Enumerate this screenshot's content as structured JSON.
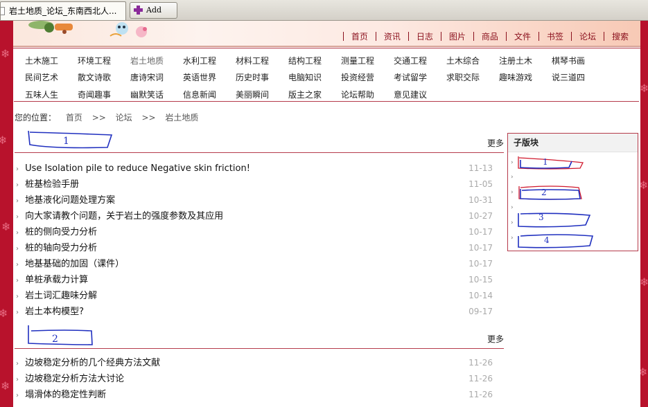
{
  "browser": {
    "active_tab": "岩土地质_论坛_东南西北人...",
    "add_tab_label": "Add Tab"
  },
  "topnav": [
    "首页",
    "资讯",
    "日志",
    "图片",
    "商品",
    "文件",
    "书签",
    "论坛",
    "搜索"
  ],
  "categories": [
    [
      "土木施工",
      "环境工程",
      "岩土地质",
      "水利工程",
      "材料工程",
      "结构工程",
      "测量工程",
      "交通工程",
      "土木综合",
      "注册土木",
      "棋琴书画"
    ],
    [
      "民间艺术",
      "散文诗歌",
      "唐诗宋词",
      "英语世界",
      "历史时事",
      "电脑知识",
      "投资经营",
      "考试留学",
      "求职交际",
      "趣味游戏",
      "说三道四"
    ],
    [
      "五味人生",
      "奇闻趣事",
      "幽默笑话",
      "信息新闻",
      "美丽瞬间",
      "版主之家",
      "论坛帮助",
      "意见建议"
    ]
  ],
  "current_category": "岩土地质",
  "breadcrumb": {
    "label": "您的位置：",
    "items": [
      "首页",
      "论坛",
      "岩土地质"
    ],
    "separator": ">>"
  },
  "sections": [
    {
      "more": "更多",
      "annotation": "1",
      "posts": [
        {
          "title": "Use Isolation pile to reduce Negative skin friction!",
          "date": "11-13"
        },
        {
          "title": "桩基检验手册",
          "date": "11-05"
        },
        {
          "title": "地基液化问题处理方案",
          "date": "10-31"
        },
        {
          "title": "向大家请教个问题，关于岩土的强度参数及其应用",
          "date": "10-27"
        },
        {
          "title": "桩的侧向受力分析",
          "date": "10-17"
        },
        {
          "title": "桩的轴向受力分析",
          "date": "10-17"
        },
        {
          "title": "地基基础的加固（课件）",
          "date": "10-17"
        },
        {
          "title": "单桩承载力计算",
          "date": "10-15"
        },
        {
          "title": "岩土词汇趣味分解",
          "date": "10-14"
        },
        {
          "title": "岩土本构模型?",
          "date": "09-17"
        }
      ]
    },
    {
      "more": "更多",
      "annotation": "2",
      "posts": [
        {
          "title": "边坡稳定分析的几个经典方法文献",
          "date": "11-26"
        },
        {
          "title": "边坡稳定分析方法大讨论",
          "date": "11-26"
        },
        {
          "title": "塌滑体的稳定性判断",
          "date": "11-26"
        }
      ]
    }
  ],
  "subforum": {
    "title": "子版块",
    "annotations": [
      "1",
      "2",
      "3",
      "4"
    ]
  },
  "colors": {
    "frame": "#b8122c",
    "accent": "#8a0f1c",
    "annotation_ink": "#1f2fbf",
    "annotation_red": "#d0182c"
  }
}
